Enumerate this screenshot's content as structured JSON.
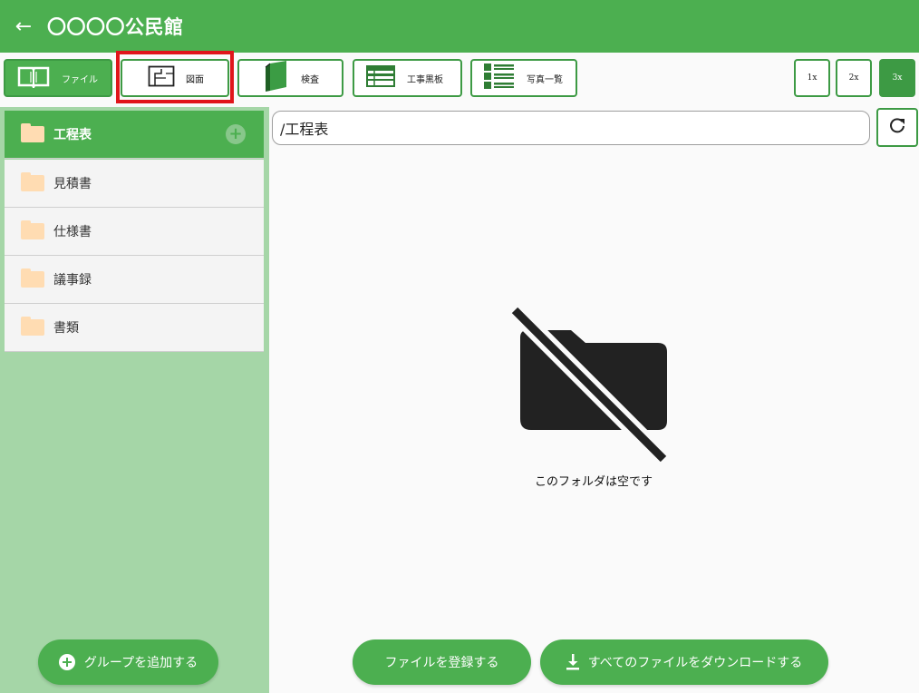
{
  "header": {
    "title": "〇〇〇〇公民館"
  },
  "toolbar": {
    "buttons": [
      {
        "label": "ファイル",
        "icon": "book-icon"
      },
      {
        "label": "図面",
        "icon": "floorplan-icon"
      },
      {
        "label": "検査",
        "icon": "binder-icon"
      },
      {
        "label": "工事黒板",
        "icon": "blackboard-icon"
      },
      {
        "label": "写真一覧",
        "icon": "list-icon"
      }
    ],
    "zoom": [
      "1x",
      "2x",
      "3x"
    ]
  },
  "sidebar": {
    "items": [
      {
        "label": "工程表"
      },
      {
        "label": "見積書"
      },
      {
        "label": "仕様書"
      },
      {
        "label": "議事録"
      },
      {
        "label": "書類"
      }
    ],
    "add_group_label": "グループを追加する"
  },
  "main": {
    "path": "/工程表",
    "empty_message": "このフォルダは空です",
    "register_label": "ファイルを登録する",
    "download_all_label": "すべてのファイルをダウンロードする"
  },
  "colors": {
    "primary": "#4caf50",
    "sidebar_bg": "#a5d6a7",
    "highlight": "#e0151b",
    "folder": "#ffdcb2"
  }
}
